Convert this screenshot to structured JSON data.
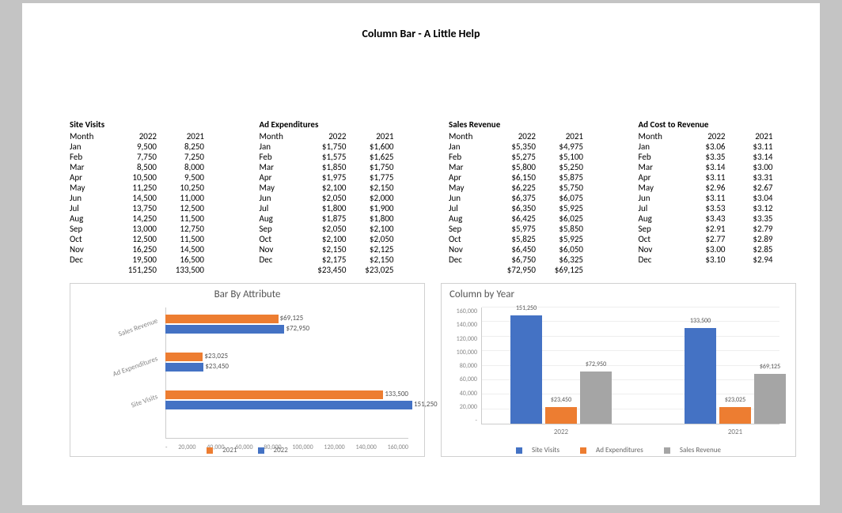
{
  "title": "Column Bar - A Little Help",
  "tables": {
    "site_visits": {
      "title": "Site Visits",
      "headers": [
        "Month",
        "2022",
        "2021"
      ],
      "rows": [
        {
          "m": "Jan",
          "a": "9,500",
          "b": "8,250"
        },
        {
          "m": "Feb",
          "a": "7,750",
          "b": "7,250"
        },
        {
          "m": "Mar",
          "a": "8,500",
          "b": "8,000"
        },
        {
          "m": "Apr",
          "a": "10,500",
          "b": "9,500"
        },
        {
          "m": "May",
          "a": "11,250",
          "b": "10,250"
        },
        {
          "m": "Jun",
          "a": "14,500",
          "b": "11,000"
        },
        {
          "m": "Jul",
          "a": "13,750",
          "b": "12,500"
        },
        {
          "m": "Aug",
          "a": "14,250",
          "b": "11,500"
        },
        {
          "m": "Sep",
          "a": "13,000",
          "b": "12,750"
        },
        {
          "m": "Oct",
          "a": "12,500",
          "b": "11,500"
        },
        {
          "m": "Nov",
          "a": "16,250",
          "b": "14,500"
        },
        {
          "m": "Dec",
          "a": "19,500",
          "b": "16,500"
        }
      ],
      "totals": {
        "a": "151,250",
        "b": "133,500"
      }
    },
    "ad_exp": {
      "title": "Ad Expenditures",
      "headers": [
        "Month",
        "2022",
        "2021"
      ],
      "rows": [
        {
          "m": "Jan",
          "a": "$1,750",
          "b": "$1,600"
        },
        {
          "m": "Feb",
          "a": "$1,575",
          "b": "$1,625"
        },
        {
          "m": "Mar",
          "a": "$1,850",
          "b": "$1,750"
        },
        {
          "m": "Apr",
          "a": "$1,975",
          "b": "$1,775"
        },
        {
          "m": "May",
          "a": "$2,100",
          "b": "$2,150"
        },
        {
          "m": "Jun",
          "a": "$2,050",
          "b": "$2,000"
        },
        {
          "m": "Jul",
          "a": "$1,800",
          "b": "$1,900"
        },
        {
          "m": "Aug",
          "a": "$1,875",
          "b": "$1,800"
        },
        {
          "m": "Sep",
          "a": "$2,050",
          "b": "$2,100"
        },
        {
          "m": "Oct",
          "a": "$2,100",
          "b": "$2,050"
        },
        {
          "m": "Nov",
          "a": "$2,150",
          "b": "$2,125"
        },
        {
          "m": "Dec",
          "a": "$2,175",
          "b": "$2,150"
        }
      ],
      "totals": {
        "a": "$23,450",
        "b": "$23,025"
      }
    },
    "sales": {
      "title": "Sales Revenue",
      "headers": [
        "Month",
        "2022",
        "2021"
      ],
      "rows": [
        {
          "m": "Jan",
          "a": "$5,350",
          "b": "$4,975"
        },
        {
          "m": "Feb",
          "a": "$5,275",
          "b": "$5,100"
        },
        {
          "m": "Mar",
          "a": "$5,800",
          "b": "$5,250"
        },
        {
          "m": "Apr",
          "a": "$6,150",
          "b": "$5,875"
        },
        {
          "m": "May",
          "a": "$6,225",
          "b": "$5,750"
        },
        {
          "m": "Jun",
          "a": "$6,375",
          "b": "$6,075"
        },
        {
          "m": "Jul",
          "a": "$6,350",
          "b": "$5,925"
        },
        {
          "m": "Aug",
          "a": "$6,425",
          "b": "$6,025"
        },
        {
          "m": "Sep",
          "a": "$5,975",
          "b": "$5,850"
        },
        {
          "m": "Oct",
          "a": "$5,825",
          "b": "$5,925"
        },
        {
          "m": "Nov",
          "a": "$6,450",
          "b": "$6,050"
        },
        {
          "m": "Dec",
          "a": "$6,750",
          "b": "$6,325"
        }
      ],
      "totals": {
        "a": "$72,950",
        "b": "$69,125"
      }
    },
    "ad_cost": {
      "title": "Ad Cost to Revenue",
      "headers": [
        "Month",
        "2022",
        "2021"
      ],
      "rows": [
        {
          "m": "Jan",
          "a": "$3.06",
          "b": "$3.11"
        },
        {
          "m": "Feb",
          "a": "$3.35",
          "b": "$3.14"
        },
        {
          "m": "Mar",
          "a": "$3.14",
          "b": "$3.00"
        },
        {
          "m": "Apr",
          "a": "$3.11",
          "b": "$3.31"
        },
        {
          "m": "May",
          "a": "$2.96",
          "b": "$2.67"
        },
        {
          "m": "Jun",
          "a": "$3.11",
          "b": "$3.04"
        },
        {
          "m": "Jul",
          "a": "$3.53",
          "b": "$3.12"
        },
        {
          "m": "Aug",
          "a": "$3.43",
          "b": "$3.35"
        },
        {
          "m": "Sep",
          "a": "$2.91",
          "b": "$2.79"
        },
        {
          "m": "Oct",
          "a": "$2.77",
          "b": "$2.89"
        },
        {
          "m": "Nov",
          "a": "$3.00",
          "b": "$2.85"
        },
        {
          "m": "Dec",
          "a": "$3.10",
          "b": "$2.94"
        }
      ],
      "totals": {
        "a": "",
        "b": ""
      }
    }
  },
  "chart_data": [
    {
      "type": "bar",
      "title": "Bar By Attribute",
      "orientation": "horizontal",
      "categories": [
        "Sales Revenue",
        "Ad Expenditures",
        "Site Visits"
      ],
      "series": [
        {
          "name": "2021",
          "values": [
            69125,
            23025,
            133500
          ],
          "color": "#ED7D31"
        },
        {
          "name": "2022",
          "values": [
            72950,
            23450,
            151250
          ],
          "color": "#4472C4"
        }
      ],
      "data_labels": {
        "2021": [
          "$69,125",
          "$23,025",
          "133,500"
        ],
        "2022": [
          "$72,950",
          "$23,450",
          "151,250"
        ]
      },
      "xlim": [
        0,
        160000
      ],
      "xticks": [
        "-",
        "20,000",
        "40,000",
        "60,000",
        "80,000",
        "100,000",
        "120,000",
        "140,000",
        "160,000"
      ],
      "legend": [
        "2021",
        "2022"
      ]
    },
    {
      "type": "bar",
      "title": "Column by Year",
      "orientation": "vertical",
      "categories": [
        "2022",
        "2021"
      ],
      "series": [
        {
          "name": "Site Visits",
          "values": [
            151250,
            133500
          ],
          "color": "#4472C4"
        },
        {
          "name": "Ad Expenditures",
          "values": [
            23450,
            23025
          ],
          "color": "#ED7D31"
        },
        {
          "name": "Sales Revenue",
          "values": [
            72950,
            69125
          ],
          "color": "#A5A5A5"
        }
      ],
      "data_labels": {
        "Site Visits": [
          "151,250",
          "133,500"
        ],
        "Ad Expenditures": [
          "$23,450",
          "$23,025"
        ],
        "Sales Revenue": [
          "$72,950",
          "$69,125"
        ]
      },
      "ylim": [
        0,
        160000
      ],
      "yticks": [
        "-",
        "20,000",
        "40,000",
        "60,000",
        "80,000",
        "100,000",
        "120,000",
        "140,000",
        "160,000"
      ],
      "legend": [
        "Site Visits",
        "Ad Expenditures",
        "Sales Revenue"
      ]
    }
  ]
}
